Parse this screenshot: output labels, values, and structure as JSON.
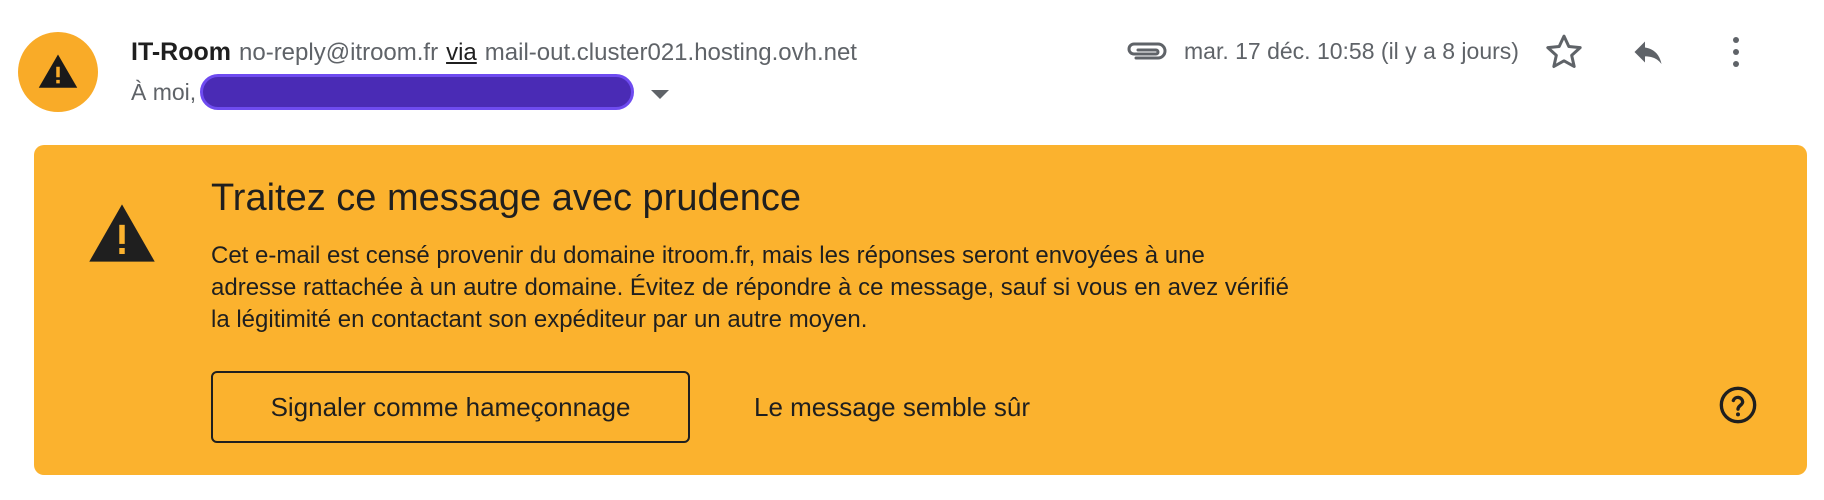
{
  "header": {
    "avatar_icon": "warning-icon",
    "sender_name": "IT-Room",
    "sender_email": "no-reply@itroom.fr",
    "via_label": "via",
    "relay_host": "mail-out.cluster021.hosting.ovh.net",
    "recipient_prefix": "À moi,",
    "date": "mar. 17 déc. 10:58 (il y a 8 jours)",
    "icons": {
      "attachment": "paperclip-icon",
      "star": "star-icon",
      "reply": "reply-icon",
      "more": "more-vert-icon",
      "recipient_details": "caret-down-icon"
    }
  },
  "warning_banner": {
    "icon": "warning-icon",
    "title": "Traitez ce message avec prudence",
    "lines": [
      "Cet e-mail est censé provenir du domaine itroom.fr, mais les réponses seront envoyées à une",
      "adresse rattachée à un autre domaine. Évitez de répondre à ce message, sauf si vous en avez vérifié",
      "la légitimité en contactant son expéditeur par un autre moyen."
    ],
    "report_button_label": "Signaler comme hameçonnage",
    "safe_button_label": "Le message semble sûr",
    "help_icon": "help-icon"
  },
  "colors": {
    "avatar_bg": "#f9ab28",
    "banner_bg": "#fbb22e",
    "redaction": "#4a2bb5",
    "text_primary": "#1f1f1f",
    "text_secondary": "#5f6368"
  }
}
